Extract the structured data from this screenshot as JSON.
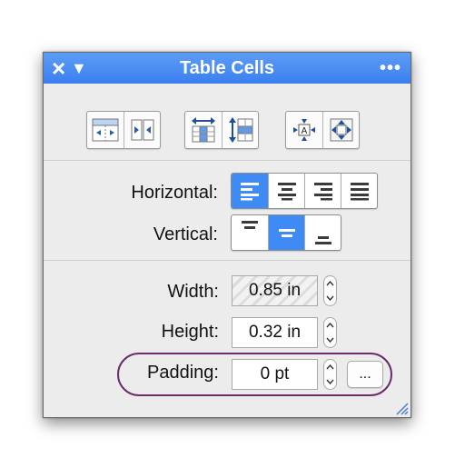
{
  "window": {
    "title": "Table Cells",
    "close_icon": "×",
    "menu_icon": "▼",
    "more_icon": "•••",
    "accent_color": "#3e8bf5",
    "titlebar_color": "#4a8ff2"
  },
  "toolbar": {
    "groups": [
      {
        "name": "insert-delete",
        "icons": [
          "insert-column-icon",
          "merge-columns-icon"
        ]
      },
      {
        "name": "distribute",
        "icons": [
          "distribute-columns-icon",
          "distribute-rows-icon"
        ]
      },
      {
        "name": "fit",
        "icons": [
          "fit-to-content-icon",
          "fit-to-cell-icon"
        ]
      }
    ]
  },
  "alignment": {
    "horizontal_label": "Horizontal:",
    "horizontal_options": [
      "align-left-icon",
      "align-center-icon",
      "align-right-icon",
      "justify-icon"
    ],
    "horizontal_selected": "align-left-icon",
    "vertical_label": "Vertical:",
    "vertical_options": [
      "align-top-icon",
      "align-middle-icon",
      "align-bottom-icon"
    ],
    "vertical_selected": "align-middle-icon"
  },
  "size": {
    "width_label": "Width:",
    "width_value": "0.85 in",
    "height_label": "Height:",
    "height_value": "0.32 in",
    "padding_label": "Padding:",
    "padding_value": "0 pt",
    "padding_more_label": "..."
  }
}
